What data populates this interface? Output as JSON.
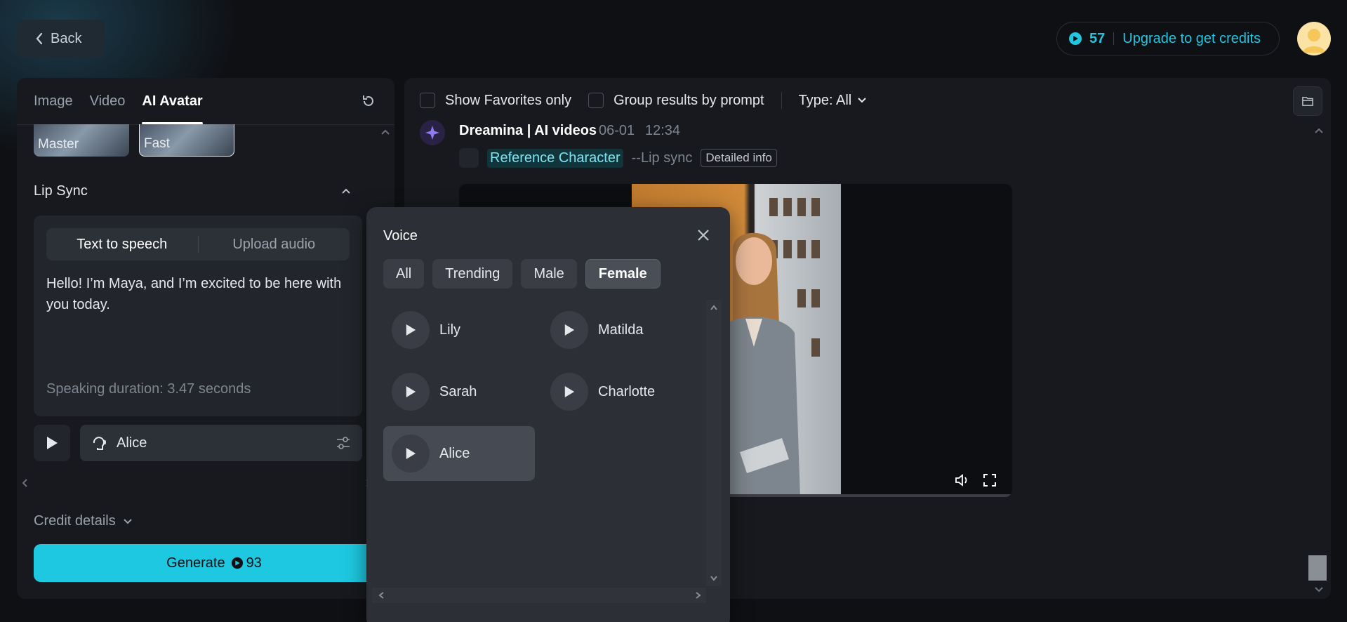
{
  "header": {
    "back_label": "Back",
    "credits_count": "57",
    "upgrade_label": "Upgrade to get credits",
    "accent_color": "#22c6e0"
  },
  "left_panel": {
    "tabs": [
      {
        "label": "Image",
        "active": false
      },
      {
        "label": "Video",
        "active": false
      },
      {
        "label": "AI Avatar",
        "active": true
      }
    ],
    "models": [
      {
        "label": "Master",
        "selected": false
      },
      {
        "label": "Fast",
        "selected": true
      }
    ],
    "lip_sync": {
      "title": "Lip Sync",
      "modes": [
        {
          "label": "Text to speech",
          "active": true
        },
        {
          "label": "Upload audio",
          "active": false
        }
      ],
      "text": "Hello! I’m Maya, and I’m excited to be here with you today.",
      "duration_text": "Speaking duration: 3.47 seconds",
      "voice_selected": "Alice"
    },
    "credit_details_label": "Credit details",
    "generate": {
      "label": "Generate",
      "credits": "93",
      "color": "#1ec8e0"
    }
  },
  "right_panel": {
    "filters": {
      "favorites_label": "Show Favorites only",
      "group_label": "Group results by prompt",
      "type_label": "Type: All"
    },
    "feed": {
      "source": "Dreamina | AI videos",
      "date": "06-01",
      "time": "12:34",
      "reference_label": "Reference Character",
      "mode_label": "--Lip sync",
      "detail_label": "Detailed info"
    }
  },
  "voice_popup": {
    "title": "Voice",
    "filters": [
      {
        "label": "All",
        "active": false
      },
      {
        "label": "Trending",
        "active": false
      },
      {
        "label": "Male",
        "active": false
      },
      {
        "label": "Female",
        "active": true
      }
    ],
    "voices": [
      {
        "name": "Lily",
        "selected": false
      },
      {
        "name": "Matilda",
        "selected": false
      },
      {
        "name": "Sarah",
        "selected": false
      },
      {
        "name": "Charlotte",
        "selected": false
      },
      {
        "name": "Alice",
        "selected": true
      }
    ]
  }
}
